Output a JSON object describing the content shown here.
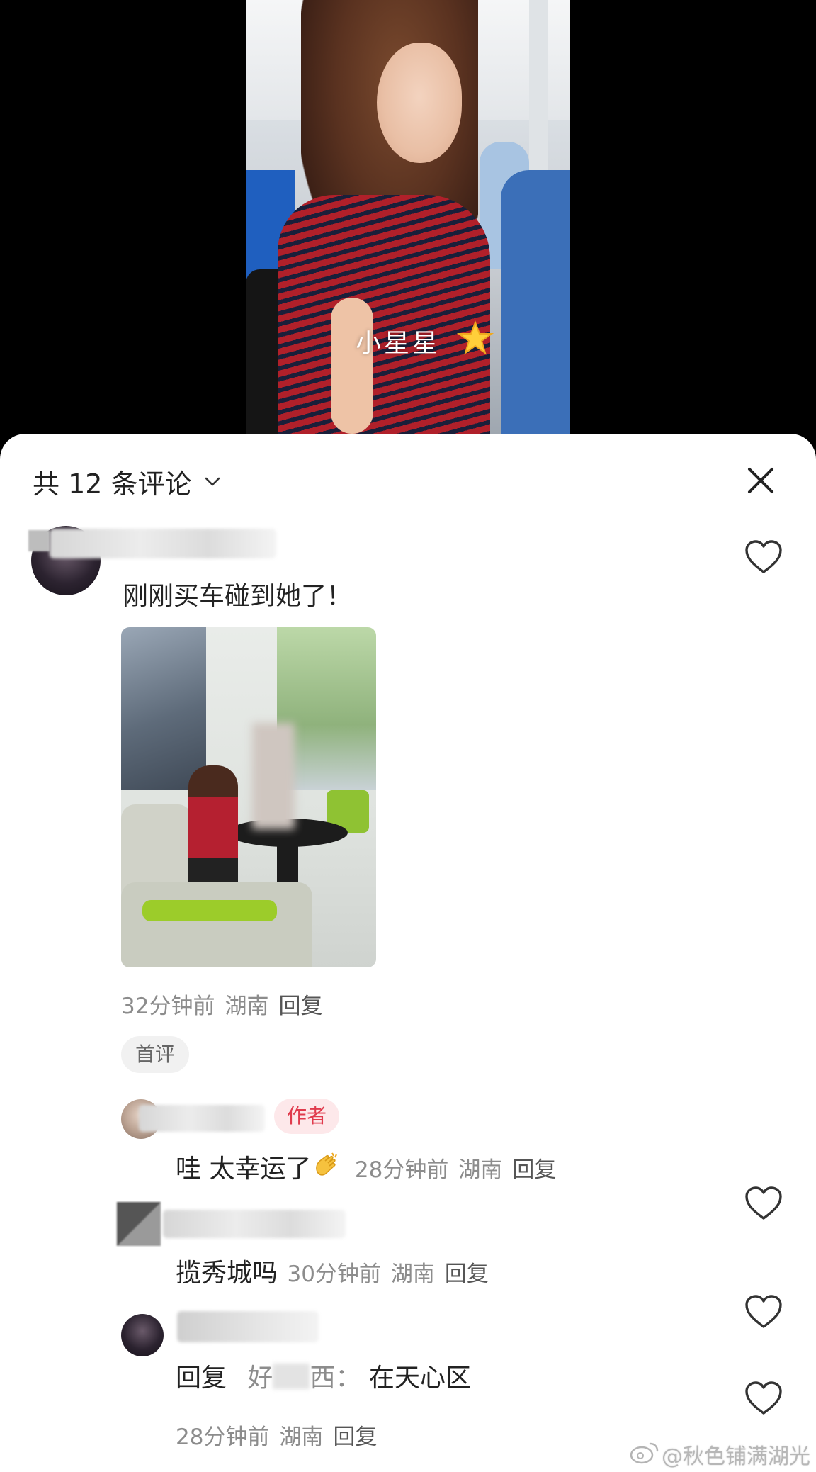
{
  "video": {
    "caption": "小星星"
  },
  "sheet": {
    "title": "共 12 条评论"
  },
  "comments": [
    {
      "text": "刚刚买车碰到她了！",
      "time": "32分钟前",
      "location": "湖南",
      "reply_label": "回复",
      "tag": "首评"
    },
    {
      "badge": "作者",
      "text": "哇 太幸运了",
      "time": "28分钟前",
      "location": "湖南",
      "reply_label": "回复"
    },
    {
      "text": "揽秀城吗",
      "time": "30分钟前",
      "location": "湖南",
      "reply_label": "回复"
    },
    {
      "text_prefix": "回复",
      "text_user": "好",
      "text_user_end": "西：",
      "text_body": "在天心区",
      "time": "28分钟前",
      "location": "湖南",
      "reply_label": "回复"
    }
  ],
  "watermark": "@秋色铺满湖光"
}
